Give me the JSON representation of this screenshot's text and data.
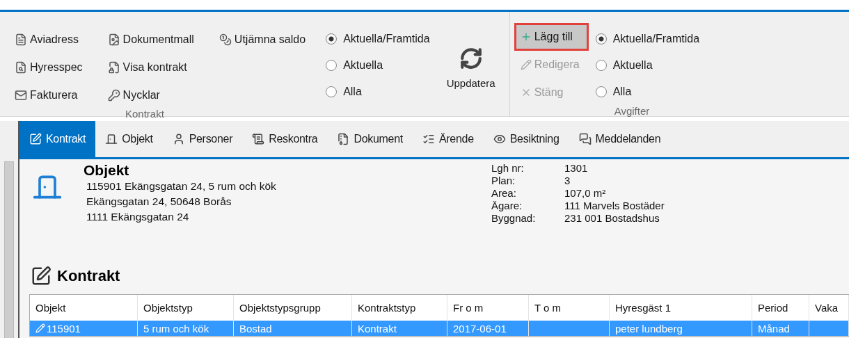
{
  "ribbon": {
    "kontrakt_group": {
      "label": "Kontrakt",
      "buttons": [
        {
          "label": "Aviadress"
        },
        {
          "label": "Hyresspec"
        },
        {
          "label": "Fakturera"
        },
        {
          "label": "Dokumentmall"
        },
        {
          "label": "Visa kontrakt"
        },
        {
          "label": "Nycklar"
        },
        {
          "label": "Utjämna saldo"
        }
      ]
    },
    "kontrakt_filter": [
      {
        "label": "Aktuella/Framtida",
        "selected": true
      },
      {
        "label": "Aktuella",
        "selected": false
      },
      {
        "label": "Alla",
        "selected": false
      }
    ],
    "refresh_button": {
      "label": "Uppdatera"
    },
    "avgifter_group": {
      "label": "Avgifter",
      "buttons": [
        {
          "label": "Lägg till",
          "disabled": false,
          "highlighted": true
        },
        {
          "label": "Redigera",
          "disabled": true,
          "highlighted": false
        },
        {
          "label": "Stäng",
          "disabled": true,
          "highlighted": false
        }
      ],
      "filter": [
        {
          "label": "Aktuella/Framtida",
          "selected": true
        },
        {
          "label": "Aktuella",
          "selected": false
        },
        {
          "label": "Alla",
          "selected": false
        }
      ]
    }
  },
  "tabs": [
    {
      "label": "Kontrakt",
      "selected": true
    },
    {
      "label": "Objekt",
      "selected": false
    },
    {
      "label": "Personer",
      "selected": false
    },
    {
      "label": "Reskontra",
      "selected": false
    },
    {
      "label": "Dokument",
      "selected": false
    },
    {
      "label": "Ärende",
      "selected": false
    },
    {
      "label": "Besiktning",
      "selected": false
    },
    {
      "label": "Meddelanden",
      "selected": false
    }
  ],
  "objekt": {
    "title": "Objekt",
    "lines": [
      "115901 Ekängsgatan 24,  5 rum och kök",
      "Ekängsgatan 24, 50648 Borås",
      "1111 Ekängsgatan 24"
    ],
    "details": [
      {
        "label": "Lgh nr:",
        "value": "1301"
      },
      {
        "label": "Plan:",
        "value": "3"
      },
      {
        "label": "Area:",
        "value": "107,0 m²"
      },
      {
        "label": "Ägare:",
        "value": "111 Marvels Bostäder"
      },
      {
        "label": "Byggnad:",
        "value": "231 001 Bostadshus"
      }
    ]
  },
  "kontrakt": {
    "title": "Kontrakt",
    "table": {
      "columns": [
        "Objekt",
        "Objektstyp",
        "Objektstypsgrupp",
        "Kontraktstyp",
        "Fr o m",
        "T o m",
        "Hyresgäst 1",
        "Period",
        "Vaka"
      ],
      "rows": [
        {
          "selected": true,
          "cells": [
            "115901",
            "5 rum och kök",
            "Bostad",
            "Kontrakt",
            "2017-06-01",
            "",
            "peter lundberg",
            "Månad",
            ""
          ]
        }
      ]
    }
  }
}
